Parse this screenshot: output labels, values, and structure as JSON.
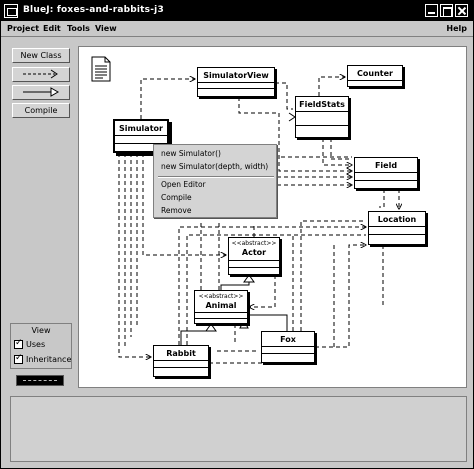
{
  "window": {
    "title": "BlueJ:  foxes-and-rabbits-j3"
  },
  "menubar": {
    "items": [
      "Project",
      "Edit",
      "Tools",
      "View"
    ],
    "help": "Help"
  },
  "toolbar": {
    "new_class": "New Class",
    "compile": "Compile",
    "uses_icon": "dashed-arrow-icon",
    "inheritance_icon": "inheritance-arrow-icon"
  },
  "view_panel": {
    "title": "View",
    "uses_label": "Uses",
    "uses_checked": true,
    "inheritance_label": "Inheritance",
    "inheritance_checked": true
  },
  "diagram": {
    "classes": {
      "simulator_view": "SimulatorView",
      "counter": "Counter",
      "field_stats": "FieldStats",
      "simulator": "Simulator",
      "field": "Field",
      "location": "Location",
      "actor": "Actor",
      "actor_stereotype": "<<abstract>>",
      "animal": "Animal",
      "animal_stereotype": "<<abstract>>",
      "rabbit": "Rabbit",
      "fox": "Fox"
    }
  },
  "context_menu": {
    "items": [
      "new Simulator()",
      "new Simulator(depth, width)",
      "Open Editor",
      "Compile",
      "Remove"
    ]
  }
}
